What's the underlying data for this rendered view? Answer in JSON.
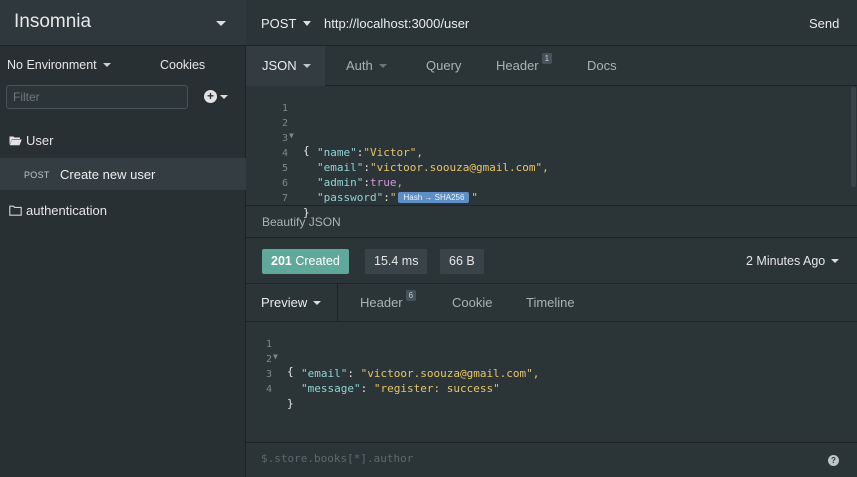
{
  "sidebar": {
    "app_title": "Insomnia",
    "environment": "No Environment",
    "cookies": "Cookies",
    "filter_placeholder": "Filter",
    "folders": [
      {
        "name": "User",
        "open": true
      },
      {
        "name": "authentication",
        "open": false
      }
    ],
    "request": {
      "method": "POST",
      "name": "Create new user"
    }
  },
  "request": {
    "method": "POST",
    "url": "http://localhost:3000/user",
    "send": "Send",
    "tabs": {
      "json": "JSON",
      "auth": "Auth",
      "query": "Query",
      "header": "Header",
      "header_count": "1",
      "docs": "Docs"
    },
    "body_lines": [
      {
        "num": "1",
        "text": ""
      },
      {
        "num": "2",
        "text": "{"
      },
      {
        "num": "3",
        "key": "\"name\"",
        "value": "\"Victor\","
      },
      {
        "num": "4",
        "key": "\"email\"",
        "value": "\"victoor.soouza@gmail.com\","
      },
      {
        "num": "5",
        "key": "\"admin\"",
        "value": "true,"
      },
      {
        "num": "6",
        "key": "\"password\"",
        "quote": "\"",
        "chip": "Hash → SHA256",
        "end": "\""
      },
      {
        "num": "7",
        "text": "}"
      }
    ],
    "beautify": "Beautify JSON"
  },
  "response": {
    "status_code": "201",
    "status_text": "Created",
    "time": "15.4 ms",
    "size": "66 B",
    "ago": "2 Minutes Ago",
    "tabs": {
      "preview": "Preview",
      "header": "Header",
      "header_count": "6",
      "cookie": "Cookie",
      "timeline": "Timeline"
    },
    "body_lines": [
      {
        "num": "1",
        "text": "{"
      },
      {
        "num": "2",
        "key": "\"email\"",
        "value": "\"victoor.soouza@gmail.com\","
      },
      {
        "num": "3",
        "key": "\"message\"",
        "value": "\"register: success\""
      },
      {
        "num": "4",
        "text": "}"
      }
    ],
    "filter_placeholder": "$.store.books[*].author"
  },
  "colors": {
    "status_ok": "#5fa89a",
    "chip": "#5d8ec5",
    "string": "#e8c46a",
    "key": "#8fd4d4",
    "bool": "#d796e0"
  }
}
